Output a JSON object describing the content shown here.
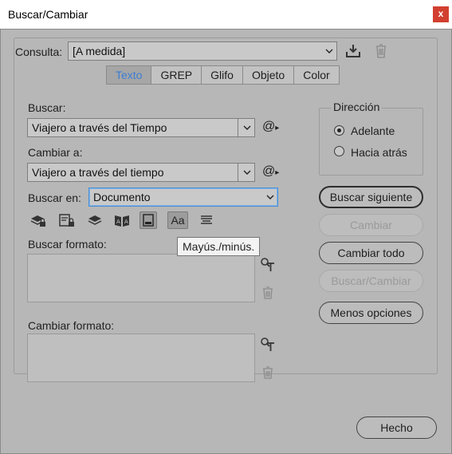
{
  "window": {
    "title": "Buscar/Cambiar",
    "close_label": "x"
  },
  "query": {
    "label": "Consulta:",
    "value": "[A medida]"
  },
  "tabs": [
    {
      "label": "Texto",
      "active": true
    },
    {
      "label": "GREP"
    },
    {
      "label": "Glifo"
    },
    {
      "label": "Objeto"
    },
    {
      "label": "Color"
    }
  ],
  "find": {
    "label": "Buscar:",
    "value": "Viajero a través del Tiempo",
    "special_char": "@"
  },
  "change": {
    "label": "Cambiar a:",
    "value": "Viajero a través del tiempo",
    "special_char": "@"
  },
  "search_in": {
    "label": "Buscar en:",
    "value": "Documento"
  },
  "find_format": {
    "label": "Buscar formato:"
  },
  "change_format": {
    "label": "Cambiar formato:"
  },
  "direction": {
    "title": "Dirección",
    "options": [
      {
        "label": "Adelante",
        "selected": true
      },
      {
        "label": "Hacia atrás",
        "selected": false
      }
    ]
  },
  "buttons": {
    "find_next": "Buscar siguiente",
    "change": "Cambiar",
    "change_all": "Cambiar todo",
    "find_change": "Buscar/Cambiar",
    "fewer_options": "Menos opciones",
    "done": "Hecho"
  },
  "options": {
    "case_sensitive_text": "Aa",
    "tooltip": "Mayús./minús."
  },
  "colors": {
    "accent": "#3b7ed4",
    "close": "#d23f2f",
    "background": "#b7b7b7"
  }
}
